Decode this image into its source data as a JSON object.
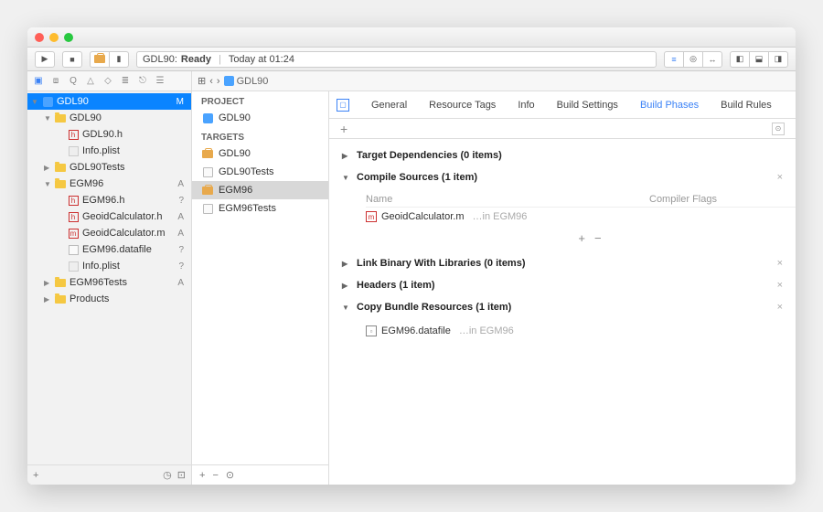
{
  "toolbar": {
    "status_prefix": "GDL90:",
    "status_state": "Ready",
    "status_time": "Today at 01:24"
  },
  "breadcrumb": {
    "project": "GDL90"
  },
  "sidebar": {
    "root": "GDL90",
    "root_status": "M",
    "items": [
      {
        "indent": 1,
        "disc": "▼",
        "icon": "folder",
        "label": "GDL90",
        "status": ""
      },
      {
        "indent": 2,
        "disc": "",
        "icon": "h",
        "label": "GDL90.h",
        "status": ""
      },
      {
        "indent": 2,
        "disc": "",
        "icon": "plist",
        "label": "Info.plist",
        "status": ""
      },
      {
        "indent": 1,
        "disc": "▶",
        "icon": "folder",
        "label": "GDL90Tests",
        "status": ""
      },
      {
        "indent": 1,
        "disc": "▼",
        "icon": "folder",
        "label": "EGM96",
        "status": "A"
      },
      {
        "indent": 2,
        "disc": "",
        "icon": "h",
        "label": "EGM96.h",
        "status": "?"
      },
      {
        "indent": 2,
        "disc": "",
        "icon": "h",
        "label": "GeoidCalculator.h",
        "status": "A"
      },
      {
        "indent": 2,
        "disc": "",
        "icon": "m",
        "label": "GeoidCalculator.m",
        "status": "A"
      },
      {
        "indent": 2,
        "disc": "",
        "icon": "file",
        "label": "EGM96.datafile",
        "status": "?"
      },
      {
        "indent": 2,
        "disc": "",
        "icon": "plist",
        "label": "Info.plist",
        "status": "?"
      },
      {
        "indent": 1,
        "disc": "▶",
        "icon": "folder",
        "label": "EGM96Tests",
        "status": "A"
      },
      {
        "indent": 1,
        "disc": "▶",
        "icon": "folder",
        "label": "Products",
        "status": ""
      }
    ]
  },
  "targets": {
    "project_hdr": "PROJECT",
    "project": "GDL90",
    "targets_hdr": "TARGETS",
    "items": [
      {
        "icon": "briefcase",
        "label": "GDL90"
      },
      {
        "icon": "test",
        "label": "GDL90Tests"
      },
      {
        "icon": "briefcase",
        "label": "EGM96"
      },
      {
        "icon": "test",
        "label": "EGM96Tests"
      }
    ]
  },
  "tabs": [
    "General",
    "Resource Tags",
    "Info",
    "Build Settings",
    "Build Phases",
    "Build Rules"
  ],
  "active_tab": 4,
  "phases": {
    "dep": "Target Dependencies (0 items)",
    "compile": "Compile Sources (1 item)",
    "compile_cols": {
      "name": "Name",
      "flags": "Compiler Flags"
    },
    "compile_file": {
      "name": "GeoidCalculator.m",
      "loc": "…in EGM96"
    },
    "link": "Link Binary With Libraries (0 items)",
    "headers": "Headers (1 item)",
    "bundle": "Copy Bundle Resources (1 item)",
    "bundle_file": {
      "name": "EGM96.datafile",
      "loc": "…in EGM96"
    }
  }
}
